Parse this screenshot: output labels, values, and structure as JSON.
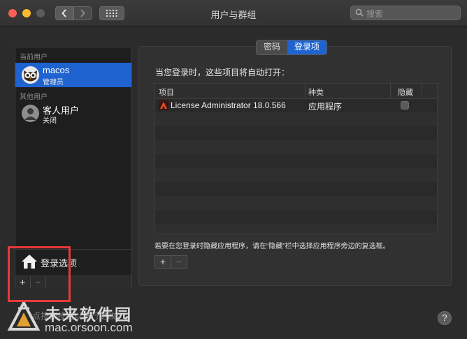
{
  "window": {
    "title": "用户与群组"
  },
  "search": {
    "placeholder": "搜索"
  },
  "sidebar": {
    "current_users_label": "当前用户",
    "current_user": {
      "name": "macos",
      "role": "管理员"
    },
    "other_users_label": "其他用户",
    "guest_user": {
      "name": "客人用户",
      "status": "关闭"
    },
    "login_options_label": "登录选项",
    "add_label": "+",
    "remove_label": "−"
  },
  "tabs": [
    {
      "label": "密码",
      "active": false
    },
    {
      "label": "登录项",
      "active": true
    }
  ],
  "login_items": {
    "intro": "当您登录时，这些项目将自动打开：",
    "columns": [
      "项目",
      "种类",
      "隐藏"
    ],
    "rows": [
      {
        "item": "License Administrator 18.0.566",
        "kind": "应用程序",
        "hidden": false
      }
    ],
    "hint": "若要在您登录时隐藏应用程序，请在“隐藏”栏中选择应用程序旁边的复选框。",
    "add_label": "+",
    "remove_label": "−"
  },
  "help": {
    "label": "?"
  },
  "watermark": {
    "brand": "未来软件园",
    "url": "mac.orsoon.com",
    "underlay": "点按锁按钮以进行更改。"
  },
  "colors": {
    "accent": "#1e63d0",
    "highlight": "#e8393a"
  }
}
